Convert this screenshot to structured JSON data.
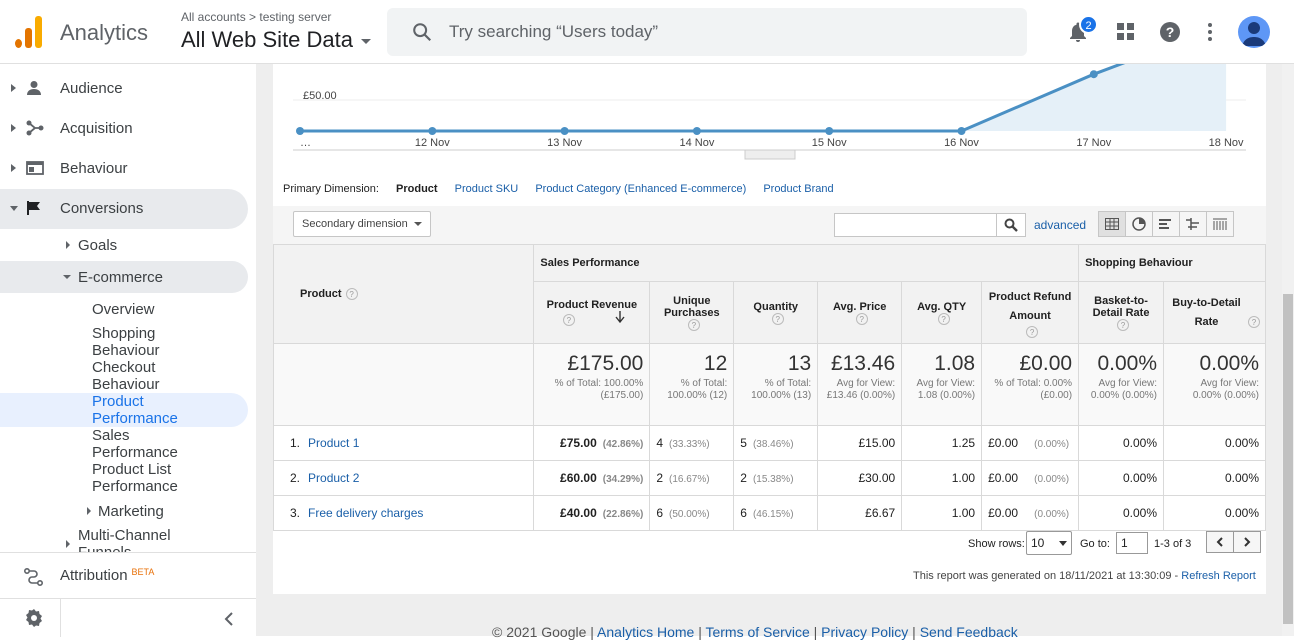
{
  "header": {
    "app_name": "Analytics",
    "account_path": "All accounts > testing server",
    "property": "All Web Site Data",
    "search_placeholder": "Try searching “Users today”",
    "notification_count": "2"
  },
  "sidebar": {
    "items": [
      {
        "label": "Audience"
      },
      {
        "label": "Acquisition"
      },
      {
        "label": "Behaviour"
      },
      {
        "label": "Conversions"
      }
    ],
    "conversions_children": {
      "goals": "Goals",
      "ecommerce": "E-commerce",
      "marketing": "Marketing",
      "multichannel": "Multi-Channel Funnels"
    },
    "ecommerce_children": [
      "Overview",
      "Shopping Behaviour",
      "Checkout Behaviour",
      "Product Performance",
      "Sales Performance",
      "Product List Performance"
    ],
    "attribution": "Attribution",
    "attribution_badge": "BETA"
  },
  "chart_data": {
    "type": "line",
    "x": [
      "…",
      "12 Nov",
      "13 Nov",
      "14 Nov",
      "15 Nov",
      "16 Nov",
      "17 Nov",
      "18 Nov"
    ],
    "y_tick_label": "£50.00",
    "values": [
      0,
      0,
      0,
      0,
      0,
      0,
      40,
      75
    ],
    "color": "#4a90c4"
  },
  "dimensions": {
    "label": "Primary Dimension:",
    "selected": "Product",
    "options": [
      "Product SKU",
      "Product Category (Enhanced E-commerce)",
      "Product Brand"
    ]
  },
  "tools": {
    "secondary_dimension": "Secondary dimension",
    "advanced": "advanced"
  },
  "table": {
    "group_sales": "Sales Performance",
    "group_shopping": "Shopping Behaviour",
    "col_product": "Product",
    "columns": [
      "Product Revenue",
      "Unique Purchases",
      "Quantity",
      "Avg. Price",
      "Avg. QTY",
      "Product Refund Amount",
      "Basket-to-Detail Rate",
      "Buy-to-Detail Rate"
    ],
    "totals": [
      {
        "big": "£175.00",
        "small": "% of Total: 100.00% (£175.00)"
      },
      {
        "big": "12",
        "small": "% of Total: 100.00% (12)"
      },
      {
        "big": "13",
        "small": "% of Total: 100.00% (13)"
      },
      {
        "big": "£13.46",
        "small": "Avg for View: £13.46 (0.00%)"
      },
      {
        "big": "1.08",
        "small": "Avg for View: 1.08 (0.00%)"
      },
      {
        "big": "£0.00",
        "small": "% of Total: 0.00% (£0.00)"
      },
      {
        "big": "0.00%",
        "small": "Avg for View: 0.00% (0.00%)"
      },
      {
        "big": "0.00%",
        "small": "Avg for View: 0.00% (0.00%)"
      }
    ],
    "rows": [
      {
        "num": "1.",
        "name": "Product 1",
        "revenue": "£75.00",
        "revenue_pct": "(42.86%)",
        "unique": "4",
        "unique_pct": "(33.33%)",
        "qty": "5",
        "qty_pct": "(38.46%)",
        "avg_price": "£15.00",
        "avg_qty": "1.25",
        "refund": "£0.00",
        "refund_pct": "(0.00%)",
        "basket": "0.00%",
        "buy": "0.00%"
      },
      {
        "num": "2.",
        "name": "Product 2",
        "revenue": "£60.00",
        "revenue_pct": "(34.29%)",
        "unique": "2",
        "unique_pct": "(16.67%)",
        "qty": "2",
        "qty_pct": "(15.38%)",
        "avg_price": "£30.00",
        "avg_qty": "1.00",
        "refund": "£0.00",
        "refund_pct": "(0.00%)",
        "basket": "0.00%",
        "buy": "0.00%"
      },
      {
        "num": "3.",
        "name": "Free delivery charges",
        "revenue": "£40.00",
        "revenue_pct": "(22.86%)",
        "unique": "6",
        "unique_pct": "(50.00%)",
        "qty": "6",
        "qty_pct": "(46.15%)",
        "avg_price": "£6.67",
        "avg_qty": "1.00",
        "refund": "£0.00",
        "refund_pct": "(0.00%)",
        "basket": "0.00%",
        "buy": "0.00%"
      }
    ]
  },
  "pager": {
    "show_rows_label": "Show rows:",
    "show_rows_value": "10",
    "goto_label": "Go to:",
    "goto_value": "1",
    "range": "1-3 of 3"
  },
  "report": {
    "generated": "This report was generated on 18/11/2021 at 13:30:09 -",
    "refresh": "Refresh Report"
  },
  "footer": {
    "copyright": "© 2021 Google |",
    "links": [
      "Analytics Home",
      "Terms of Service",
      "Privacy Policy",
      "Send Feedback"
    ]
  }
}
